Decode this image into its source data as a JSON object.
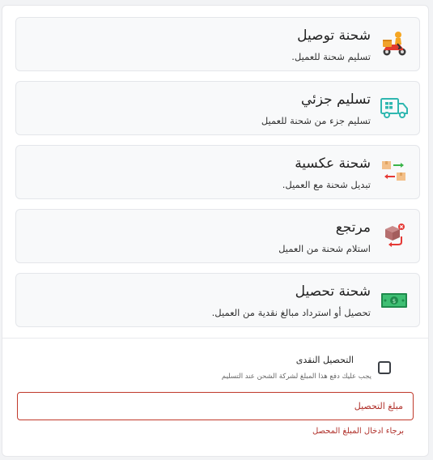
{
  "shipment_types": [
    {
      "title": "شحنة توصيل",
      "description": "تسليم شحنة للعميل.",
      "icon": "delivery-scooter-icon"
    },
    {
      "title": "تسليم جزئي",
      "description": "تسليم جزء من شحنة للعميل",
      "icon": "delivery-truck-icon"
    },
    {
      "title": "شحنة عكسية",
      "description": "تبديل شحنة مع العميل.",
      "icon": "exchange-boxes-icon"
    },
    {
      "title": "مرتجع",
      "description": "استلام شحنة من العميل",
      "icon": "return-box-icon"
    },
    {
      "title": "شحنة تحصيل",
      "description": "تحصيل أو استرداد مبالغ نقدية من العميل.",
      "icon": "cash-banknote-icon"
    }
  ],
  "cash_collection": {
    "label": "التحصيل النقدى",
    "hint": "يجب عليك دفع هذا المبلغ لشركة الشحن عند التسليم",
    "checked": false
  },
  "amount_field": {
    "placeholder": "مبلغ التحصيل",
    "value": "",
    "error": "برجاء ادخال المبلغ المحصل"
  },
  "colors": {
    "error": "#c0392b",
    "card_background": "#f8f9fa",
    "icon_teal": "#2fb7b0",
    "icon_green": "#1f8a4c"
  }
}
